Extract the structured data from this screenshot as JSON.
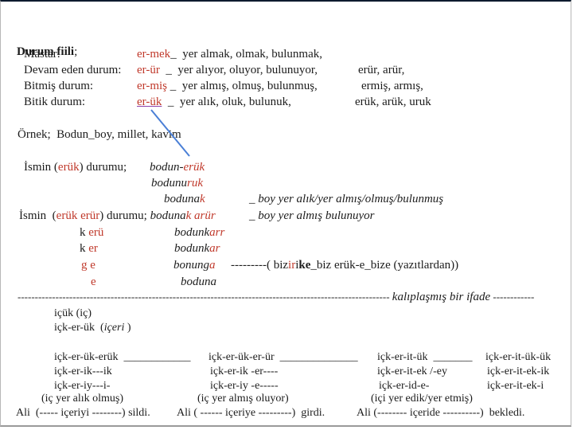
{
  "title": {
    "text": "Durum fiili",
    "sep": ";"
  },
  "suffix_table": [
    {
      "label": "Mastar:",
      "suffix": "er-mek",
      "tail": "_  yer almak, olmak, bulunmak,",
      "extra": ""
    },
    {
      "label": "Devam eden durum:",
      "suffix": "er-ür",
      "tail": "  _  yer alıyor, oluyor, bulunuyor,",
      "extra": "erür, arür,"
    },
    {
      "label": "Bitmiş durum:",
      "suffix": "er-miş",
      "tail": " _  yer almış, olmuş, bulunmuş,",
      "extra": "ermiş, armış,"
    },
    {
      "label": "Bitik durum:",
      "suffix": "er-ük",
      "tail": "  _  yer alık, oluk, bulunuk,",
      "extra": "erük, arük, uruk"
    }
  ],
  "example_label": "Örnek;  Bodun_boy, millet, kavim",
  "case1": {
    "pre": "İsmin (",
    "key": "erük",
    "post": ") durumu;",
    "word": "bodun-",
    "word_suffix": "erük"
  },
  "case1_forms": [
    {
      "stem": "bodunu",
      "suffix": "ruk"
    },
    {
      "stem": "boduna",
      "suffix": "k"
    }
  ],
  "case1_note": "_ boy yer alık/yer almış/olmuş/bulunmuş",
  "case2": {
    "pre": "İsmin  (",
    "k1": "erük",
    "k2": "erür",
    "post": ") durumu;",
    "stem": "boduna",
    "s1": "k",
    "s2": "arür",
    "note": "_ boy yer almış bulunuyor"
  },
  "case2_rows": [
    {
      "left": "k",
      "left_red": "erü",
      "stem": "bodunk",
      "suffix": "arr"
    },
    {
      "left": "k",
      "left_red": " er",
      "stem": "bodunk",
      "suffix": "ar"
    },
    {
      "left": "g",
      "left_red": " e",
      "stem": "bonung",
      "suffix": "a"
    },
    {
      "left": "",
      "left_red": "e",
      "stem": "boduna",
      "suffix": ""
    }
  ],
  "bonunga_note": {
    "dash": "---------( biz",
    "r1": "ir",
    "m": "i",
    "r2": "ke",
    "rest": "_biz erük-e_bize (yazıtlardan))"
  },
  "divider": {
    "dashes": "------------------------------------------------------------------------------------------------------------",
    "label": "kalıplaşmış bir ifade",
    "tail": "------------"
  },
  "icuk": {
    "line1": "içük (iç)",
    "line2": "içk-er-ük  (",
    "line2_i": "içeri",
    "line2_end": " )"
  },
  "columns": [
    {
      "head": "içk-er-ük-erük  ____________",
      "l1": "içk-er-ik---ik",
      "l2": "içk-er-iy---i-",
      "l3": "(iç yer alık olmuş)",
      "l4": "Ali  (----- içeriyi --------) sildi."
    },
    {
      "head": "içk-er-ük-er-ür  ______________",
      "l1": "içk-er-ik -er----",
      "l2": "içk-er-iy -e-----",
      "l3": "(iç yer almış oluyor)",
      "l4": "Ali ( ------ içeriye ---------)  girdi."
    },
    {
      "head": "içk-er-it-ük  _______",
      "l1": "içk-er-it-ek /-ey",
      "l2": "içk-er-id-e-",
      "l3": "(içi yer edik/yer etmiş)",
      "l4": "Ali (-------- içeride ----------)  bekledi."
    },
    {
      "head": "içk-er-it-ük-ük",
      "l1": "içk-er-it-ek-ik",
      "l2": "içk-er-it-ek-i",
      "l3": "",
      "l4": ""
    }
  ]
}
